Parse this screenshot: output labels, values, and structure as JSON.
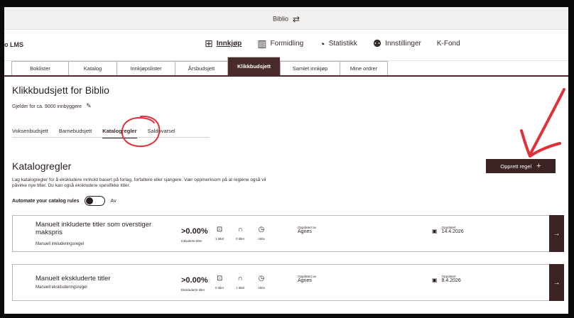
{
  "top": {
    "brand": "Biblio",
    "swap_icon": "⇄"
  },
  "mainnav": {
    "lms": "o LMS",
    "items": [
      {
        "icon": "basket-icon",
        "glyph": "⊞",
        "label": "Innkjøp"
      },
      {
        "icon": "books-icon",
        "glyph": "▥",
        "label": "Formidling"
      },
      {
        "icon": "pie-chart-icon",
        "glyph": "◔",
        "label": "Statistikk"
      },
      {
        "icon": "org-icon",
        "glyph": "⚉",
        "label": "Innstillinger"
      },
      {
        "icon": "",
        "glyph": "",
        "label": "K-Fond"
      }
    ]
  },
  "subtabs": [
    "Boklister",
    "Katalog",
    "Innkjøpslister",
    "Årsbudsjett",
    "Klikkbudsjett",
    "Samlet innkjøp",
    "Mine ordrer"
  ],
  "page": {
    "title": "Klikkbudsjett for Biblio",
    "population": "Gjelder for ca. 9000 innbyggere",
    "budget_tabs": [
      "Voksenbudsjett",
      "Barnebudsjett",
      "Katalogregler",
      "Saldovarsel"
    ],
    "section_title": "Katalogregler",
    "description": "Lag katalogregler for å ekskludere innhold basert på forlag, forfattere eller sjangere. Vær oppmerksom på at reglene også vil påvirke nye titler. Du kan også ekskludere spesifikke titler.",
    "automate_label": "Automate your catalog rules",
    "toggle_state": "Av",
    "create_label": "Opprett regel"
  },
  "rules": [
    {
      "name": "Manuelt inkluderte titler som overstiger makspris",
      "type": "Manuell inkluderingsregel",
      "pct": ">0.00%",
      "pct_label": "Inkluderte titler",
      "titles": "1 tittel",
      "listeners": "0 titler",
      "status": "Aktiv",
      "updated_by_label": "Oppdatert av",
      "updated_by": "Agnes",
      "updated_label": "Oppdatert",
      "updated_date": "14.4.2026"
    },
    {
      "name": "Manuelt ekskluderte titler",
      "type": "Manuell ekskluderingsregel",
      "pct": ">0.00%",
      "pct_label": "Ekskluderte titler",
      "titles": "0 titler",
      "listeners": "1 tittel",
      "status": "Aktiv",
      "updated_by_label": "Oppdatert av",
      "updated_by": "Agnes",
      "updated_label": "Oppdatert",
      "updated_date": "8.4.2026"
    }
  ],
  "colors": {
    "accent": "#3b2323",
    "annotation": "#e0303a"
  }
}
